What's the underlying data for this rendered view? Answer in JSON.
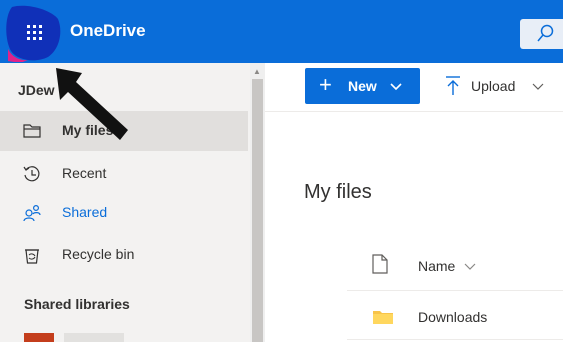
{
  "header": {
    "app_name": "OneDrive",
    "waffle_icon": "app-launcher-icon",
    "search_icon": "search-icon",
    "brand_color": "#0a6dd9"
  },
  "sidebar": {
    "user_name": "JDew",
    "items": [
      {
        "label": "My files",
        "icon": "folder-icon",
        "active": true
      },
      {
        "label": "Recent",
        "icon": "clock-icon"
      },
      {
        "label": "Shared",
        "icon": "people-icon"
      },
      {
        "label": "Recycle bin",
        "icon": "trash-icon"
      }
    ],
    "section_title": "Shared libraries"
  },
  "toolbar": {
    "new_label": "New",
    "upload_label": "Upload"
  },
  "main": {
    "title": "My files",
    "column_name": "Name",
    "rows": [
      {
        "name": "Downloads",
        "type": "folder"
      }
    ]
  }
}
